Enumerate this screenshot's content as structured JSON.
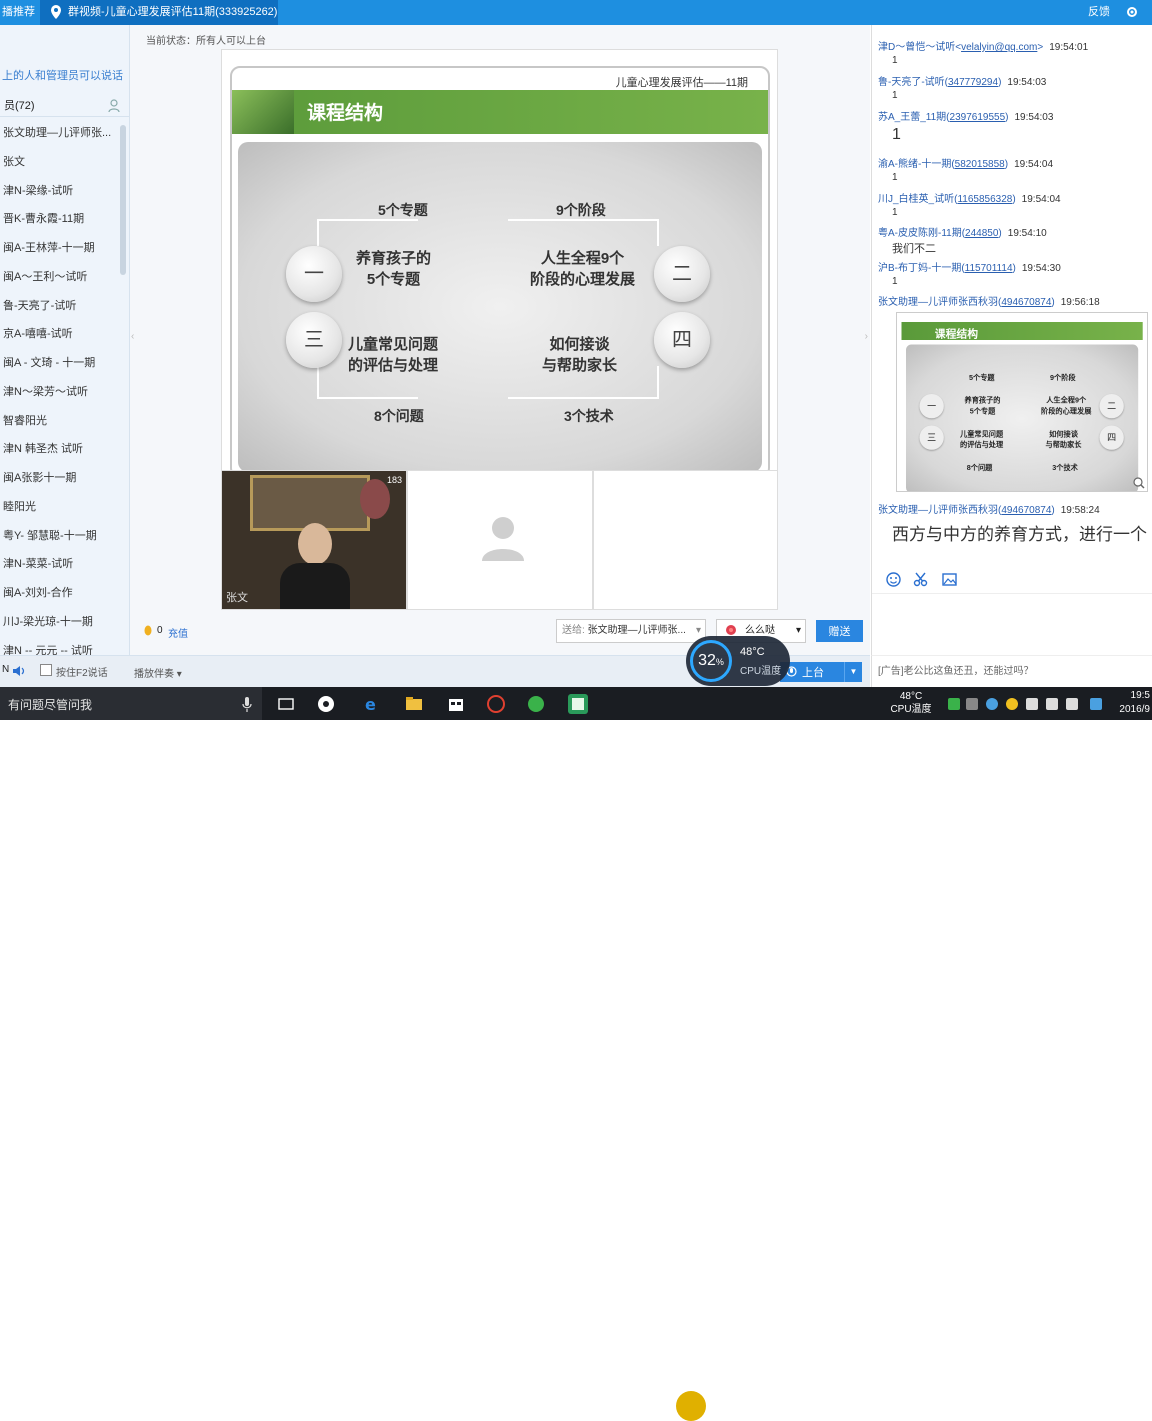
{
  "topbar": {
    "recommend_tab": "播推荐",
    "active_tab": "群视频-儿童心理发展评估11期(333925262)",
    "feedback": "反馈"
  },
  "left": {
    "notice": "上的人和管理员可以说话",
    "count": "员(72)",
    "members": [
      "张文助理—儿评师张...",
      "张文",
      "津N-梁缘-试听",
      "晋K-曹永霞-11期",
      "闽A-王林萍-十一期",
      "闽A～王利～试听",
      "鲁-天亮了-试听",
      "京A-嘻嘻-试听",
      "闽A - 文琦 - 十一期",
      "津N～梁芳～试听",
      "智睿阳光",
      "津N 韩圣杰 试听",
      "闽A张影十一期",
      "睦阳光",
      "粤Y- 邹慧聪-十一期",
      "津N-菜菜-试听",
      "闽A-刘刘-合作",
      "川J-梁光琼-十一期",
      "津N -- 元元 -- 试听"
    ]
  },
  "main": {
    "status": "当前状态：所有人可以上台",
    "slide": {
      "subtitle": "儿童心理发展评估——11期",
      "title": "课程结构",
      "top_left": "5个专题",
      "top_right": "9个阶段",
      "mid1_left": "养育孩子的\n5个专题",
      "mid1_right": "人生全程9个\n阶段的心理发展",
      "mid2_left": "儿童常见问题\n的评估与处理",
      "mid2_right": "如何接谈\n与帮助家长",
      "bottom_left": "8个问题",
      "bottom_right": "3个技术",
      "circle1": "一",
      "circle2": "二",
      "circle3": "三",
      "circle4": "四"
    },
    "video": {
      "name": "张文",
      "viewers": "183"
    },
    "coin_count": "0",
    "recharge": "充值",
    "sendto_label": "送给:",
    "sendto_target": "张文助理—儿评师张...",
    "gift_label": "么么哒",
    "send_button": "赠送"
  },
  "leftbottom": {
    "n_label": "N",
    "f2_label": "按住F2说话",
    "companion": "播放伴奏",
    "onstage": "上台"
  },
  "cpu_overlay": {
    "percent": "32",
    "percent_sign": "%",
    "temp": "48°C",
    "label": "CPU温度"
  },
  "chat": {
    "messages": [
      {
        "nick": "津D～曾恺～试听<",
        "qq": "velalyin@qq.com",
        "suffix": ">",
        "time": "19:54:01",
        "text": "1"
      },
      {
        "nick": "鲁-天亮了-试听(",
        "qq": "347779294",
        "suffix": ")",
        "time": "19:54:03",
        "text": "1"
      },
      {
        "nick": "苏A_王蕾_11期(",
        "qq": "2397619555",
        "suffix": ")",
        "time": "19:54:03",
        "text": "1"
      },
      {
        "nick": "渝A-熊绪-十一期(",
        "qq": "582015858",
        "suffix": ")",
        "time": "19:54:04",
        "text": "1"
      },
      {
        "nick": "川J_白桂英_试听(",
        "qq": "1165856328",
        "suffix": ")",
        "time": "19:54:04",
        "text": "1"
      },
      {
        "nick": "粤A-皮皮陈刚-11期(",
        "qq": "244850",
        "suffix": ")",
        "time": "19:54:10",
        "text": "我们不二"
      },
      {
        "nick": "沪B-布丁妈-十一期(",
        "qq": "115701114",
        "suffix": ")",
        "time": "19:54:30",
        "text": "1"
      },
      {
        "nick": "张文助理—儿评师张西秋羽(",
        "qq": "494670874",
        "suffix": ")",
        "time": "19:56:18",
        "text": ""
      },
      {
        "nick": "张文助理—儿评师张西秋羽(",
        "qq": "494670874",
        "suffix": ")",
        "time": "19:58:24",
        "text": "西方与中方的养育方式，进行一个"
      }
    ],
    "ad": "[广告]老公比这鱼还丑，还能过吗？"
  },
  "taskbar": {
    "search_placeholder": "有问题尽管问我",
    "cpu_temp": "48°C",
    "cpu_label": "CPU温度",
    "time": "19:5",
    "date": "2016/9"
  },
  "colors": {
    "titlebar": "#1e8fe0",
    "accent": "#2a86e0",
    "slide_banner": "#5a9a3a"
  }
}
